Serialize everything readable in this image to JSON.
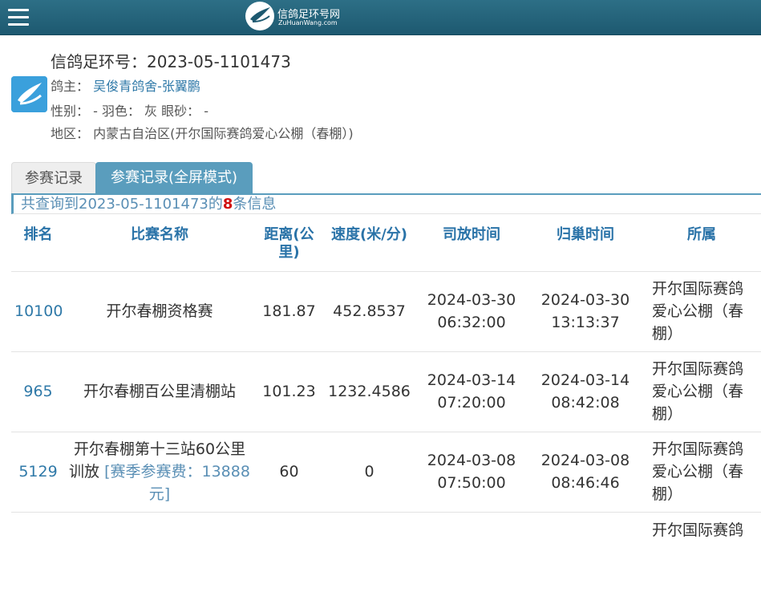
{
  "header": {
    "logo_title": "信鸽足环号网",
    "logo_subtitle": "ZuHuanWang.com",
    "menu_icon": "hamburger-menu-icon",
    "colors": {
      "bar": "#2d6f86",
      "accent": "#5a9dbd",
      "link": "#2f79a8",
      "highlight": "#d01010"
    }
  },
  "profile": {
    "ring_label": "信鸽足环号：",
    "ring_number": "2023-05-1101473",
    "owner_label": "鸽主：",
    "owner_name": "吴俊青鸽舍-张翼鹏",
    "attributes_text": "性别：  - 羽色：  灰  眼砂：  -",
    "region_label": "地区：",
    "region_value": "内蒙古自治区(开尔国际赛鸽爱心公棚（春棚）)"
  },
  "tabs": [
    {
      "label": "参赛记录"
    },
    {
      "label": "参赛记录(全屏模式)"
    }
  ],
  "summary": {
    "prefix": "共查询到2023-05-1101473的",
    "count": "8",
    "suffix": "条信息"
  },
  "table": {
    "columns": [
      "排名",
      "比赛名称",
      "距离(公里)",
      "速度(米/分)",
      "司放时间",
      "归巢时间",
      "所属"
    ],
    "rows": [
      {
        "rank": "10100",
        "race": "开尔春棚资格赛",
        "fee": "",
        "distance": "181.87",
        "speed": "452.8537",
        "release_date": "2024-03-30",
        "release_time": "06:32:00",
        "return_date": "2024-03-30",
        "return_time": "13:13:37",
        "loft": "开尔国际赛鸽爱心公棚（春棚）"
      },
      {
        "rank": "965",
        "race": "开尔春棚百公里清棚站",
        "fee": "",
        "distance": "101.23",
        "speed": "1232.4586",
        "release_date": "2024-03-14",
        "release_time": "07:20:00",
        "return_date": "2024-03-14",
        "return_time": "08:42:08",
        "loft": "开尔国际赛鸽爱心公棚（春棚）"
      },
      {
        "rank": "5129",
        "race": "开尔春棚第十三站60公里训放",
        "fee": "[赛季参赛费：13888元]",
        "distance": "60",
        "speed": "0",
        "release_date": "2024-03-08",
        "release_time": "07:50:00",
        "return_date": "2024-03-08",
        "return_time": "08:46:46",
        "loft": "开尔国际赛鸽爱心公棚（春棚）"
      }
    ],
    "partial_next_row_loft": "开尔国际赛鸽"
  }
}
